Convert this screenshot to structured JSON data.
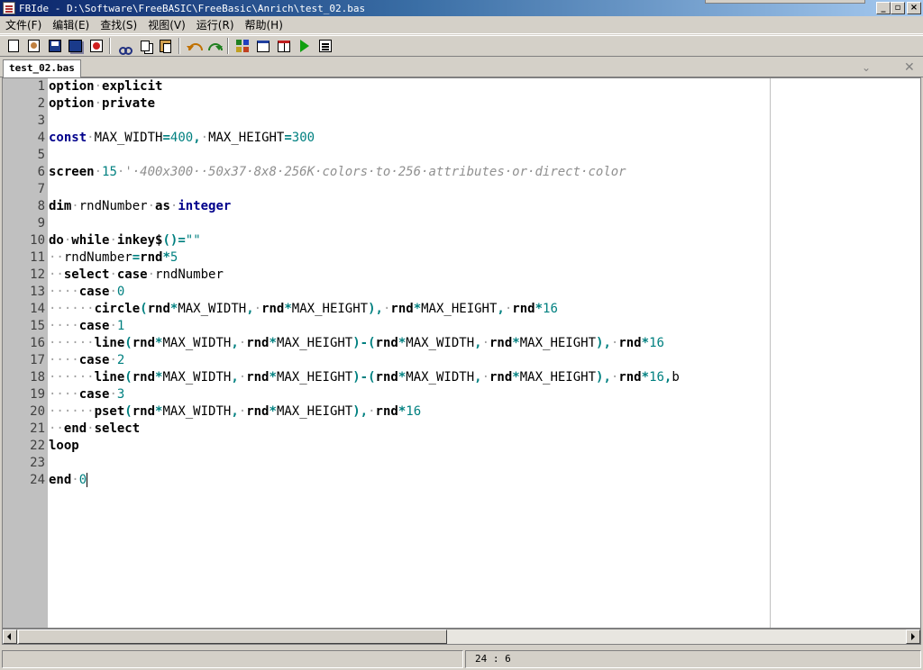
{
  "window": {
    "title": "FBIde - D:\\Software\\FreeBASIC\\FreeBasic\\Anrich\\test_02.bas",
    "controls": [
      "minimize",
      "maximize",
      "close"
    ]
  },
  "menu": [
    {
      "label": "文件(F)"
    },
    {
      "label": "编辑(E)"
    },
    {
      "label": "查找(S)"
    },
    {
      "label": "视图(V)"
    },
    {
      "label": "运行(R)"
    },
    {
      "label": "帮助(H)"
    }
  ],
  "toolbar": {
    "icons": [
      "new-file-icon",
      "open-file-icon",
      "save-icon",
      "save-all-icon",
      "close-file-icon",
      "cut-icon",
      "copy-icon",
      "paste-icon",
      "undo-icon",
      "redo-icon",
      "compile-icon",
      "window-icon",
      "window-split-icon",
      "run-icon",
      "console-icon"
    ]
  },
  "tabs": [
    {
      "label": "test_02.bas",
      "active": true
    }
  ],
  "editor": {
    "lines": [
      {
        "n": "1",
        "tokens": [
          [
            "k",
            "option"
          ],
          [
            "w",
            "·"
          ],
          [
            "k",
            "explicit"
          ]
        ]
      },
      {
        "n": "2",
        "tokens": [
          [
            "k",
            "option"
          ],
          [
            "w",
            "·"
          ],
          [
            "k",
            "private"
          ]
        ]
      },
      {
        "n": "3",
        "tokens": []
      },
      {
        "n": "4",
        "tokens": [
          [
            "t",
            "const"
          ],
          [
            "w",
            "·"
          ],
          [
            "i",
            "MAX_WIDTH"
          ],
          [
            "o",
            "="
          ],
          [
            "n",
            "400"
          ],
          [
            "o",
            ","
          ],
          [
            "w",
            "·"
          ],
          [
            "i",
            "MAX_HEIGHT"
          ],
          [
            "o",
            "="
          ],
          [
            "n",
            "300"
          ]
        ]
      },
      {
        "n": "5",
        "tokens": []
      },
      {
        "n": "6",
        "tokens": [
          [
            "k",
            "screen"
          ],
          [
            "w",
            "·"
          ],
          [
            "n",
            "15"
          ],
          [
            "w",
            "·"
          ],
          [
            "c",
            "'·400x300··50x37·8x8·256K·colors·to·256·attributes·or·direct·color"
          ]
        ]
      },
      {
        "n": "7",
        "tokens": []
      },
      {
        "n": "8",
        "tokens": [
          [
            "k",
            "dim"
          ],
          [
            "w",
            "·"
          ],
          [
            "i",
            "rndNumber"
          ],
          [
            "w",
            "·"
          ],
          [
            "k",
            "as"
          ],
          [
            "w",
            "·"
          ],
          [
            "t",
            "integer"
          ]
        ]
      },
      {
        "n": "9",
        "tokens": []
      },
      {
        "n": "10",
        "tokens": [
          [
            "k",
            "do"
          ],
          [
            "w",
            "·"
          ],
          [
            "k",
            "while"
          ],
          [
            "w",
            "·"
          ],
          [
            "k",
            "inkey$"
          ],
          [
            "o",
            "()="
          ],
          [
            "s",
            "\"\""
          ]
        ]
      },
      {
        "n": "11",
        "tokens": [
          [
            "w",
            "··"
          ],
          [
            "i",
            "rndNumber"
          ],
          [
            "o",
            "="
          ],
          [
            "k",
            "rnd"
          ],
          [
            "o",
            "*"
          ],
          [
            "n",
            "5"
          ]
        ]
      },
      {
        "n": "12",
        "tokens": [
          [
            "w",
            "··"
          ],
          [
            "k",
            "select"
          ],
          [
            "w",
            "·"
          ],
          [
            "k",
            "case"
          ],
          [
            "w",
            "·"
          ],
          [
            "i",
            "rndNumber"
          ]
        ]
      },
      {
        "n": "13",
        "tokens": [
          [
            "w",
            "····"
          ],
          [
            "k",
            "case"
          ],
          [
            "w",
            "·"
          ],
          [
            "n",
            "0"
          ]
        ]
      },
      {
        "n": "14",
        "tokens": [
          [
            "w",
            "······"
          ],
          [
            "k",
            "circle"
          ],
          [
            "o",
            "("
          ],
          [
            "k",
            "rnd"
          ],
          [
            "o",
            "*"
          ],
          [
            "i",
            "MAX_WIDTH"
          ],
          [
            "o",
            ","
          ],
          [
            "w",
            "·"
          ],
          [
            "k",
            "rnd"
          ],
          [
            "o",
            "*"
          ],
          [
            "i",
            "MAX_HEIGHT"
          ],
          [
            "o",
            "),"
          ],
          [
            "w",
            "·"
          ],
          [
            "k",
            "rnd"
          ],
          [
            "o",
            "*"
          ],
          [
            "i",
            "MAX_HEIGHT"
          ],
          [
            "o",
            ","
          ],
          [
            "w",
            "·"
          ],
          [
            "k",
            "rnd"
          ],
          [
            "o",
            "*"
          ],
          [
            "n",
            "16"
          ]
        ]
      },
      {
        "n": "15",
        "tokens": [
          [
            "w",
            "····"
          ],
          [
            "k",
            "case"
          ],
          [
            "w",
            "·"
          ],
          [
            "n",
            "1"
          ]
        ]
      },
      {
        "n": "16",
        "tokens": [
          [
            "w",
            "······"
          ],
          [
            "k",
            "line"
          ],
          [
            "o",
            "("
          ],
          [
            "k",
            "rnd"
          ],
          [
            "o",
            "*"
          ],
          [
            "i",
            "MAX_WIDTH"
          ],
          [
            "o",
            ","
          ],
          [
            "w",
            "·"
          ],
          [
            "k",
            "rnd"
          ],
          [
            "o",
            "*"
          ],
          [
            "i",
            "MAX_HEIGHT"
          ],
          [
            "o",
            ")-("
          ],
          [
            "k",
            "rnd"
          ],
          [
            "o",
            "*"
          ],
          [
            "i",
            "MAX_WIDTH"
          ],
          [
            "o",
            ","
          ],
          [
            "w",
            "·"
          ],
          [
            "k",
            "rnd"
          ],
          [
            "o",
            "*"
          ],
          [
            "i",
            "MAX_HEIGHT"
          ],
          [
            "o",
            "),"
          ],
          [
            "w",
            "·"
          ],
          [
            "k",
            "rnd"
          ],
          [
            "o",
            "*"
          ],
          [
            "n",
            "16"
          ]
        ]
      },
      {
        "n": "17",
        "tokens": [
          [
            "w",
            "····"
          ],
          [
            "k",
            "case"
          ],
          [
            "w",
            "·"
          ],
          [
            "n",
            "2"
          ]
        ]
      },
      {
        "n": "18",
        "tokens": [
          [
            "w",
            "······"
          ],
          [
            "k",
            "line"
          ],
          [
            "o",
            "("
          ],
          [
            "k",
            "rnd"
          ],
          [
            "o",
            "*"
          ],
          [
            "i",
            "MAX_WIDTH"
          ],
          [
            "o",
            ","
          ],
          [
            "w",
            "·"
          ],
          [
            "k",
            "rnd"
          ],
          [
            "o",
            "*"
          ],
          [
            "i",
            "MAX_HEIGHT"
          ],
          [
            "o",
            ")-("
          ],
          [
            "k",
            "rnd"
          ],
          [
            "o",
            "*"
          ],
          [
            "i",
            "MAX_WIDTH"
          ],
          [
            "o",
            ","
          ],
          [
            "w",
            "·"
          ],
          [
            "k",
            "rnd"
          ],
          [
            "o",
            "*"
          ],
          [
            "i",
            "MAX_HEIGHT"
          ],
          [
            "o",
            "),"
          ],
          [
            "w",
            "·"
          ],
          [
            "k",
            "rnd"
          ],
          [
            "o",
            "*"
          ],
          [
            "n",
            "16"
          ],
          [
            "o",
            ","
          ],
          [
            "i",
            "b"
          ]
        ]
      },
      {
        "n": "19",
        "tokens": [
          [
            "w",
            "····"
          ],
          [
            "k",
            "case"
          ],
          [
            "w",
            "·"
          ],
          [
            "n",
            "3"
          ]
        ]
      },
      {
        "n": "20",
        "tokens": [
          [
            "w",
            "······"
          ],
          [
            "k",
            "pset"
          ],
          [
            "o",
            "("
          ],
          [
            "k",
            "rnd"
          ],
          [
            "o",
            "*"
          ],
          [
            "i",
            "MAX_WIDTH"
          ],
          [
            "o",
            ","
          ],
          [
            "w",
            "·"
          ],
          [
            "k",
            "rnd"
          ],
          [
            "o",
            "*"
          ],
          [
            "i",
            "MAX_HEIGHT"
          ],
          [
            "o",
            "),"
          ],
          [
            "w",
            "·"
          ],
          [
            "k",
            "rnd"
          ],
          [
            "o",
            "*"
          ],
          [
            "n",
            "16"
          ]
        ]
      },
      {
        "n": "21",
        "tokens": [
          [
            "w",
            "··"
          ],
          [
            "k",
            "end"
          ],
          [
            "w",
            "·"
          ],
          [
            "k",
            "select"
          ]
        ]
      },
      {
        "n": "22",
        "tokens": [
          [
            "k",
            "loop"
          ]
        ]
      },
      {
        "n": "23",
        "tokens": []
      },
      {
        "n": "24",
        "tokens": [
          [
            "k",
            "end"
          ],
          [
            "w",
            "·"
          ],
          [
            "n",
            "0"
          ]
        ],
        "cursor": true
      }
    ]
  },
  "status": {
    "left": "",
    "position": "24 : 6"
  },
  "colors": {
    "titlebar_start": "#0a246a",
    "titlebar_end": "#a6caf0",
    "keyword": "#000000",
    "type_keyword": "#00008b",
    "number": "#008080",
    "comment": "#909090",
    "gutter": "#c0c0c0"
  }
}
